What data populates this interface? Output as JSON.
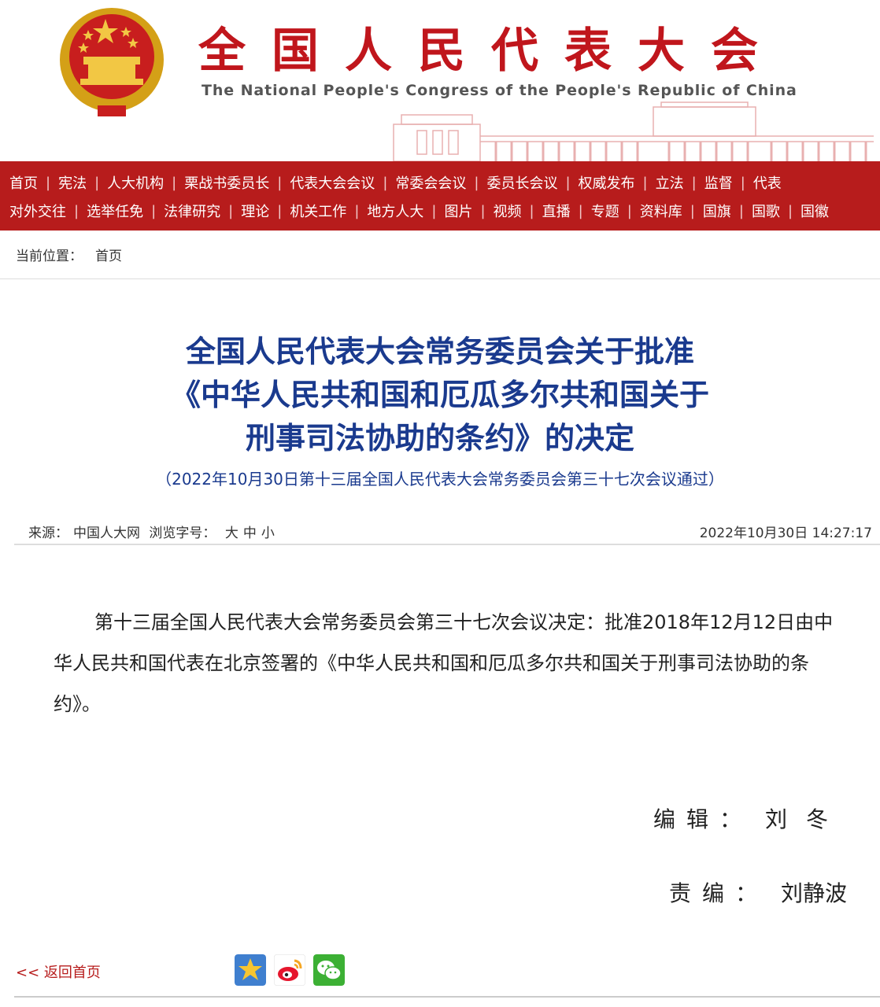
{
  "header": {
    "site_title": "全国人民代表大会",
    "site_subtitle": "The National People's Congress of the People's Republic of China"
  },
  "nav": {
    "row1": [
      "首页",
      "宪法",
      "人大机构",
      "栗战书委员长",
      "代表大会会议",
      "常委会会议",
      "委员长会议",
      "权威发布",
      "立法",
      "监督",
      "代表"
    ],
    "row2": [
      "对外交往",
      "选举任免",
      "法律研究",
      "理论",
      "机关工作",
      "地方人大",
      "图片",
      "视频",
      "直播",
      "专题",
      "资料库",
      "国旗",
      "国歌",
      "国徽"
    ]
  },
  "breadcrumb": {
    "label": "当前位置：",
    "home": "首页"
  },
  "article": {
    "title_lines": [
      "全国人民代表大会常务委员会关于批准",
      "《中华人民共和国和厄瓜多尔共和国关于",
      "刑事司法协助的条约》的决定"
    ],
    "subtitle": "（2022年10月30日第十三届全国人民代表大会常务委员会第三十七次会议通过）",
    "meta": {
      "source_label": "来源：",
      "source": "中国人大网",
      "font_label": "浏览字号：",
      "font_large": "大",
      "font_medium": "中",
      "font_small": "小",
      "datetime": "2022年10月30日 14:27:17"
    },
    "body": "第十三届全国人民代表大会常务委员会第三十七次会议决定：批准2018年12月12日由中华人民共和国代表在北京签署的《中华人民共和国和厄瓜多尔共和国关于刑事司法协助的条约》。",
    "editor_label": "编辑：",
    "editor_name": "刘冬",
    "chief_editor_label": "责编：",
    "chief_editor_name": "刘静波"
  },
  "footer": {
    "back_link": "<< 返回首页",
    "share_icons": [
      "qq-zone-icon",
      "weibo-icon",
      "wechat-icon"
    ]
  },
  "colors": {
    "brand_red": "#b71c1c",
    "title_blue": "#1a3a8e"
  }
}
